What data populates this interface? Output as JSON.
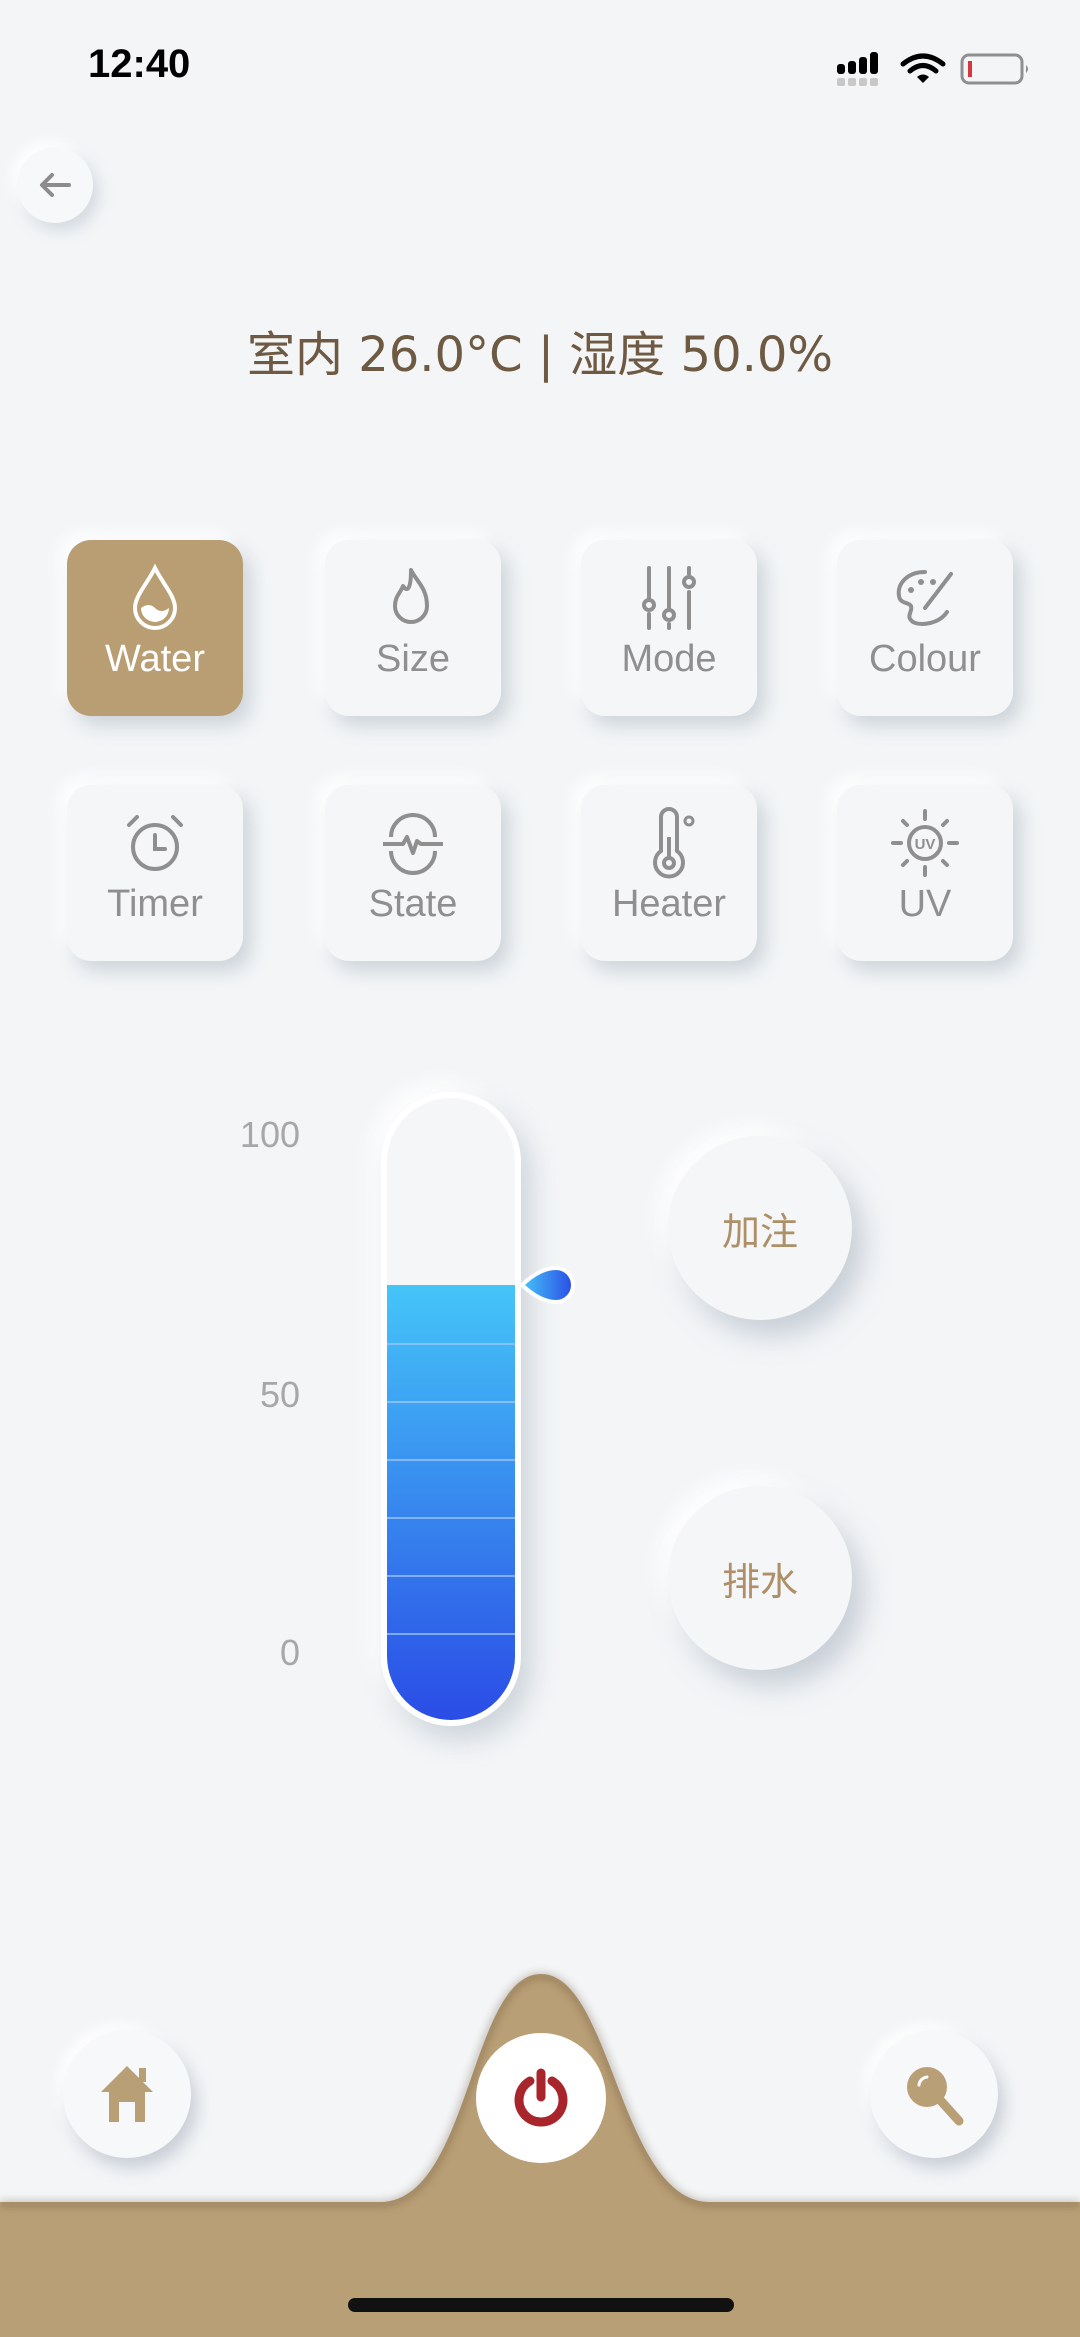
{
  "status_bar": {
    "time": "12:40",
    "battery_level": 0.1,
    "icons": [
      "cellular-signal-icon",
      "wifi-icon",
      "battery-low-icon"
    ]
  },
  "header": {
    "title": "室内 26.0°C | 湿度 50.0%"
  },
  "colors": {
    "accent": "#b99d73",
    "background": "#f3f5f7",
    "water_top": "#45c5f8",
    "water_bottom": "#2a4ce6",
    "power": "#a8252b",
    "header_text": "#6e5a42"
  },
  "tiles": [
    {
      "label": "Water",
      "icon": "water-drop-icon",
      "active": true
    },
    {
      "label": "Size",
      "icon": "flame-icon",
      "active": false
    },
    {
      "label": "Mode",
      "icon": "sliders-icon",
      "active": false
    },
    {
      "label": "Colour",
      "icon": "palette-icon",
      "active": false
    },
    {
      "label": "Timer",
      "icon": "alarm-clock-icon",
      "active": false
    },
    {
      "label": "State",
      "icon": "pulse-icon",
      "active": false
    },
    {
      "label": "Heater",
      "icon": "thermometer-icon",
      "active": false
    },
    {
      "label": "UV",
      "icon": "uv-sun-icon",
      "active": false
    }
  ],
  "gauge": {
    "ticks": [
      "100",
      "50",
      "0"
    ],
    "min": 0,
    "max": 100,
    "water_level": 74
  },
  "actions": {
    "fill_label": "加注",
    "drain_label": "排水"
  },
  "bottom_nav": {
    "items": [
      "home-icon",
      "power-icon",
      "search-icon"
    ]
  }
}
